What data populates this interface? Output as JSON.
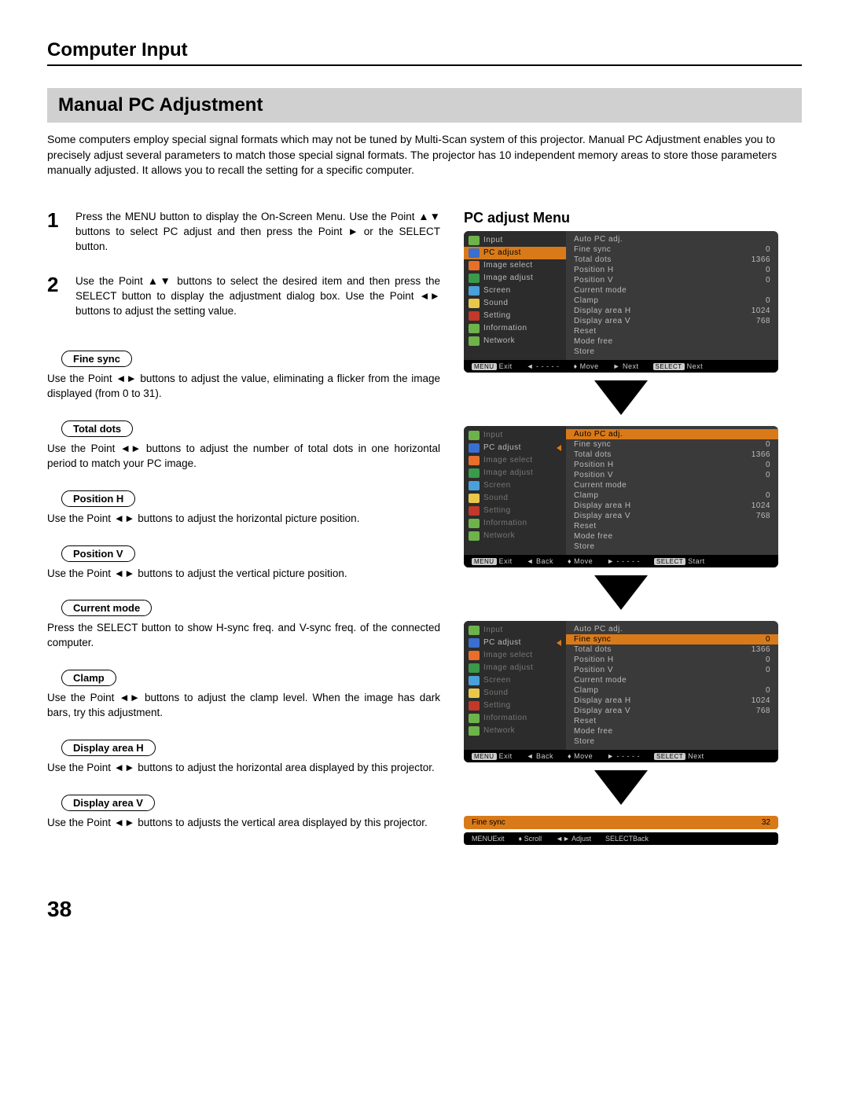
{
  "header": "Computer Input",
  "subsection": "Manual PC Adjustment",
  "intro": "Some computers employ special signal formats which may not be tuned by Multi-Scan system of this projector. Manual PC Adjustment enables you to precisely adjust several parameters to match those special signal formats. The projector has 10 independent memory areas to store those parameters manually adjusted. It allows you to recall the setting for a specific computer.",
  "steps": [
    {
      "num": "1",
      "text": "Press the MENU button to display the On-Screen Menu. Use the Point ▲▼ buttons to select PC adjust and then press the Point ► or the SELECT button."
    },
    {
      "num": "2",
      "text": "Use the Point ▲▼ buttons to select the desired item and then press the SELECT button to display the adjustment dialog box. Use the Point ◄► buttons to adjust the setting value."
    }
  ],
  "params": [
    {
      "title": "Fine sync",
      "desc": "Use the Point ◄► buttons to adjust the value, eliminating a flicker from the image displayed (from 0 to 31)."
    },
    {
      "title": "Total dots",
      "desc": "Use the Point ◄► buttons to adjust the number of total dots in one horizontal period to match your PC image."
    },
    {
      "title": "Position H",
      "desc": "Use the Point ◄► buttons to adjust the horizontal picture position."
    },
    {
      "title": "Position V",
      "desc": "Use the Point ◄► buttons to adjust the vertical picture position."
    },
    {
      "title": "Current mode",
      "desc": "Press the SELECT button to show H-sync freq. and V-sync freq. of the connected computer."
    },
    {
      "title": "Clamp",
      "desc": "Use the Point ◄► buttons to adjust the clamp level. When the image has dark bars, try this adjustment."
    },
    {
      "title": "Display area H",
      "desc": "Use the Point ◄► buttons to adjust the horizontal area displayed by this projector."
    },
    {
      "title": "Display area V",
      "desc": "Use the Point ◄► buttons to adjusts the vertical area displayed by this projector."
    }
  ],
  "right_title": "PC adjust Menu",
  "menu_left": [
    "Input",
    "PC adjust",
    "Image select",
    "Image adjust",
    "Screen",
    "Sound",
    "Setting",
    "Information",
    "Network"
  ],
  "menu_right": [
    {
      "l": "Auto PC adj.",
      "v": ""
    },
    {
      "l": "Fine sync",
      "v": "0"
    },
    {
      "l": "Total dots",
      "v": "1366"
    },
    {
      "l": "Position H",
      "v": "0"
    },
    {
      "l": "Position V",
      "v": "0"
    },
    {
      "l": "Current mode",
      "v": ""
    },
    {
      "l": "Clamp",
      "v": "0"
    },
    {
      "l": "Display area H",
      "v": "1024"
    },
    {
      "l": "Display area V",
      "v": "768"
    },
    {
      "l": "Reset",
      "v": ""
    },
    {
      "l": "Mode free",
      "v": ""
    },
    {
      "l": "Store",
      "v": ""
    }
  ],
  "footer1": [
    "MENU Exit",
    "◄ - - - - -",
    "♦ Move",
    "► Next",
    "SELECT Next"
  ],
  "footer2": [
    "MENU Exit",
    "◄ Back",
    "♦ Move",
    "► - - - - -",
    "SELECT Start"
  ],
  "footer3": [
    "MENU Exit",
    "◄ Back",
    "♦ Move",
    "► - - - - -",
    "SELECT Next"
  ],
  "mini": {
    "label": "Fine sync",
    "value": "32"
  },
  "footer4": [
    "MENU Exit",
    "♦ Scroll",
    "◄► Adjust",
    "SELECT Back"
  ],
  "icon_colors": [
    "#6eb24b",
    "#3a6ecf",
    "#e76f2a",
    "#3a994a",
    "#4aa0d8",
    "#e8c84a",
    "#c0392b",
    "#6eb24b",
    "#6eb24b"
  ],
  "page_number": "38"
}
